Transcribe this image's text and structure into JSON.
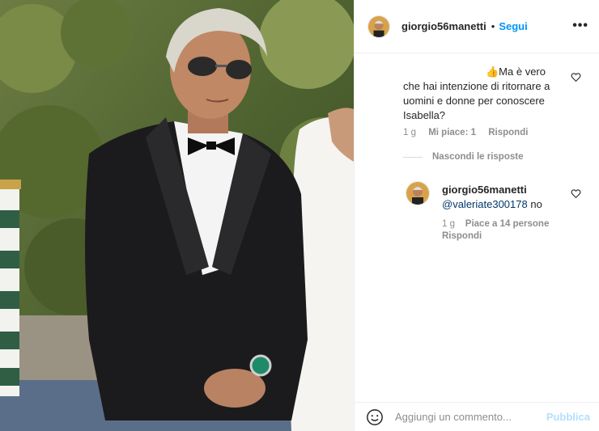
{
  "header": {
    "username": "giorgio56manetti",
    "separator": "•",
    "follow_label": "Segui",
    "more_label": "•••"
  },
  "comment": {
    "text": "👍Ma è vero che hai intenzione di ritornare a uomini e donne per conoscere Isabella?",
    "time": "1 g",
    "likes": "Mi piace: 1",
    "reply_label": "Rispondi"
  },
  "replies_toggle": {
    "label": "Nascondi le risposte"
  },
  "reply": {
    "username": "giorgio56manetti",
    "mention": "@valeriate300178",
    "text": "no",
    "time": "1 g",
    "likes": "Piace a 14 persone",
    "reply_label": "Rispondi"
  },
  "add_comment": {
    "placeholder": "Aggiungi un commento...",
    "publish_label": "Pubblica"
  },
  "icons": {
    "header_avatar": "avatar-icon",
    "comment_like": "heart-icon",
    "reply_like": "heart-icon",
    "emoji": "smiley-icon"
  },
  "colors": {
    "link_blue": "#0095f6",
    "publish_disabled": "#b2dffc",
    "secondary_text": "#8e8e8e",
    "mention": "#00376b"
  }
}
